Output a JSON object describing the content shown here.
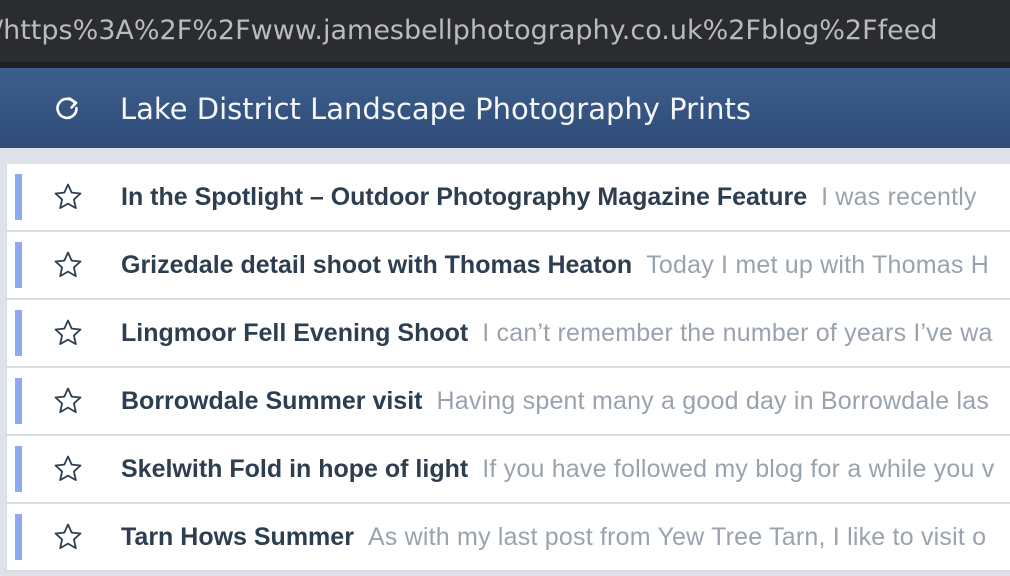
{
  "browser": {
    "url": "/https%3A%2F%2Fwww.jamesbellphotography.co.uk%2Fblog%2Ffeed"
  },
  "header": {
    "refresh_icon": "refresh-icon",
    "title": "Lake District Landscape Photography Prints"
  },
  "colors": {
    "header_bg": "#2f4c78",
    "unread_bar": "#8fa9f0",
    "title_text": "#2c3e50",
    "snippet_text": "#9aa3ad"
  },
  "articles": [
    {
      "title": "In the Spotlight – Outdoor Photography Magazine Feature",
      "snippet": "I was recently"
    },
    {
      "title": "Grizedale detail shoot with Thomas Heaton",
      "snippet": "Today I met up with Thomas H"
    },
    {
      "title": "Lingmoor Fell Evening Shoot",
      "snippet": "I can’t remember the number of years I’ve wa"
    },
    {
      "title": "Borrowdale Summer visit",
      "snippet": "Having spent many a good day in Borrowdale las"
    },
    {
      "title": "Skelwith Fold in hope of light",
      "snippet": "If you have followed my blog for a while you v"
    },
    {
      "title": "Tarn Hows Summer",
      "snippet": "As with my last post from Yew Tree Tarn, I like to visit o"
    }
  ]
}
